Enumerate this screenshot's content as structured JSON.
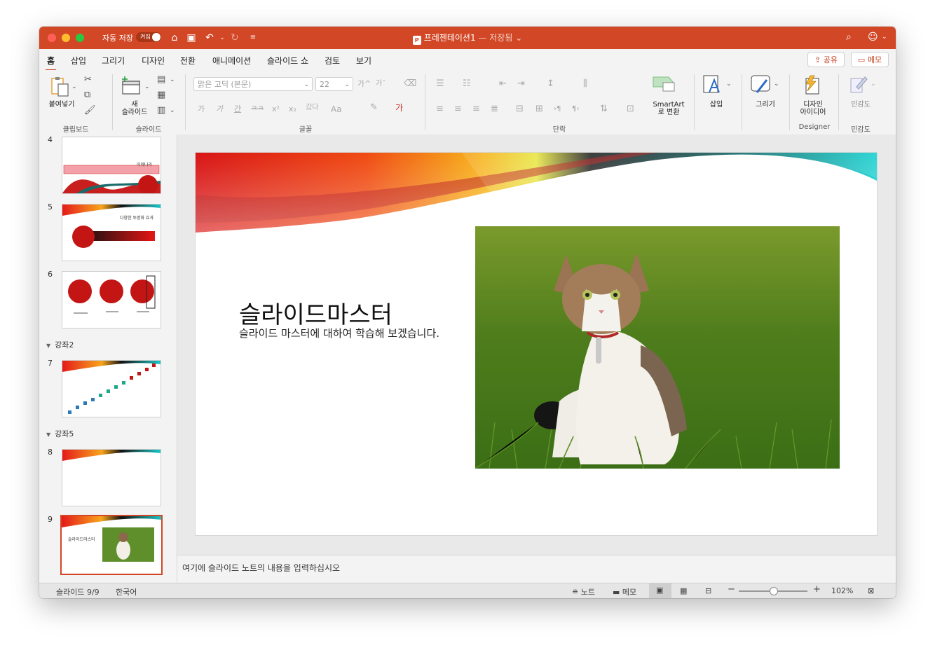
{
  "window": {
    "autosave_label": "자동 저장",
    "autosave_state": "켜짐",
    "doc_title": "프레젠테이션1",
    "doc_saved": "— 저장됨 ⌄",
    "app_badge": "P"
  },
  "tabs": [
    "홈",
    "삽입",
    "그리기",
    "디자인",
    "전환",
    "애니메이션",
    "슬라이드 쇼",
    "검토",
    "보기"
  ],
  "share_label": "공유",
  "memo_label": "메모",
  "ribbon": {
    "paste_label": "붙여넣기",
    "clipboard_group": "클립보드",
    "new_slide_label_1": "새",
    "new_slide_label_2": "슬라이드",
    "slides_group": "슬라이드",
    "font_name": "맑은 고딕 (본문)",
    "font_size": "22",
    "font_group": "글꼴",
    "paragraph_group": "단락",
    "smartart_label_1": "SmartArt",
    "smartart_label_2": "로 변환",
    "insert_label": "삽입",
    "draw_label": "그리기",
    "design_ideas_label_1": "디자인",
    "design_ideas_label_2": "아이디어",
    "designer_group": "Designer",
    "sensitivity_label": "민감도",
    "sensitivity_group": "민감도",
    "font_buttons": [
      "가",
      "가",
      "간",
      "ㅋㅋ",
      "x²",
      "x₂",
      "갔다",
      "Aa",
      "가"
    ],
    "grow_font": "가^",
    "shrink_font": "가ˇ"
  },
  "thumbnails": {
    "items": [
      {
        "num": "4",
        "text": "이제나라"
      },
      {
        "num": "5",
        "text": "다양한 투명화 효과"
      },
      {
        "num": "6",
        "text": ""
      },
      {
        "num": "7",
        "text": ""
      },
      {
        "num": "8",
        "text": ""
      },
      {
        "num": "9",
        "text": "슬라이드마스터"
      }
    ],
    "sections": [
      "강좌2",
      "강좌5"
    ]
  },
  "slide": {
    "title": "슬라이드마스터",
    "subtitle": "슬라이드 마스터에 대하여 학습해 보겠습니다."
  },
  "notes_placeholder": "여기에 슬라이드 노트의 내용을 입력하십시오",
  "status": {
    "slide_count": "슬라이드 9/9",
    "language": "한국어",
    "notes": "노트",
    "memo": "메모",
    "zoom": "102%",
    "zoom_level": 102
  }
}
